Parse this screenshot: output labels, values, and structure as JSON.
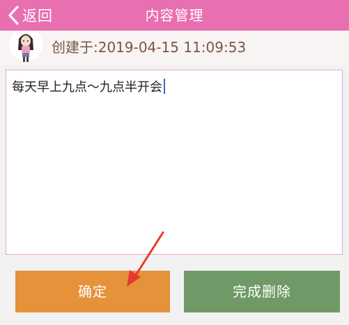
{
  "nav": {
    "back_label": "返回",
    "title": "内容管理"
  },
  "info": {
    "created_text": "创建于:2019-04-15 11:09:53"
  },
  "content": {
    "text": "每天早上九点～九点半开会"
  },
  "buttons": {
    "confirm_label": "确定",
    "delete_label": "完成删除"
  },
  "colors": {
    "nav_bg": "#e86fb0",
    "confirm_bg": "#e5923a",
    "delete_bg": "#6f9a67",
    "annotation": "#e83a2a"
  },
  "icons": {
    "back": "chevron-left-icon",
    "avatar": "user-avatar-illustration",
    "annotation": "red-arrow-annotation"
  }
}
